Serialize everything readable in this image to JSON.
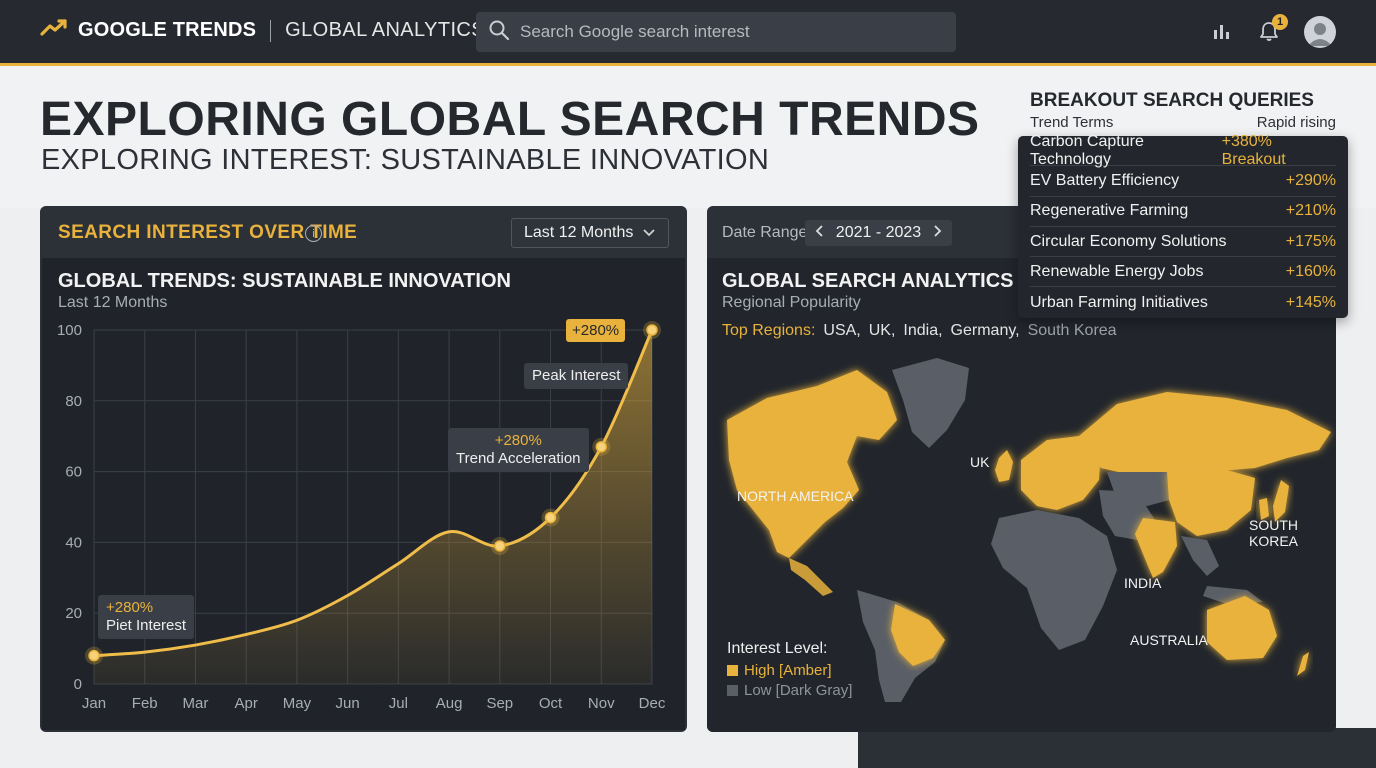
{
  "topbar": {
    "brand": "GOOGLE TRENDS",
    "section": "GLOBAL ANALYTICS",
    "search_placeholder": "Search Google search interest",
    "notification_count": "1",
    "accent": "#e8b23c"
  },
  "hero": {
    "title": "EXPLORING GLOBAL SEARCH TRENDS",
    "subtitle": "EXPLORING INTEREST: SUSTAINABLE INNOVATION"
  },
  "interest_panel": {
    "section_title": "SEARCH INTEREST OVER TIME",
    "timeframe": "Last 12 Months",
    "card_title": "GLOBAL TRENDS: SUSTAINABLE INNOVATION",
    "card_subtitle": "Last 12 Months",
    "annotations": {
      "start_change": "+280%",
      "start_label": "Piet Interest",
      "mid_change": "+280%",
      "mid_label": "Trend Acceleration",
      "peak_label": "Peak Interest",
      "peak_change": "+280%"
    }
  },
  "chart_data": {
    "type": "area",
    "title": "GLOBAL TRENDS: SUSTAINABLE INNOVATION",
    "subtitle": "Last 12 Months",
    "categories": [
      "Jan",
      "Feb",
      "Mar",
      "Apr",
      "May",
      "Jun",
      "Jul",
      "Aug",
      "Sep",
      "Oct",
      "Nov",
      "Dec"
    ],
    "values": [
      8,
      9,
      11,
      14,
      18,
      25,
      34,
      43,
      39,
      47,
      67,
      100
    ],
    "markers": [
      "Jan",
      "Sep",
      "Oct",
      "Nov",
      "Dec"
    ],
    "ylim": [
      0,
      100
    ],
    "yticks": [
      0,
      20,
      40,
      60,
      80,
      100
    ],
    "grid": true,
    "color": "#e8b23c"
  },
  "map_panel": {
    "date_label": "Date Range",
    "date_range": "2021 - 2023",
    "title": "GLOBAL SEARCH ANALYTICS MAP",
    "subtitle": "Regional Popularity",
    "top_regions_label": "Top Regions:",
    "top_regions": [
      "USA,",
      "UK,",
      "India,",
      "Germany,",
      "South Korea"
    ],
    "labels": {
      "north_america": "NORTH AMERICA",
      "uk": "UK",
      "south_korea": "SOUTH KOREA",
      "india": "INDIA",
      "australia": "AUSTRALIA"
    },
    "legend_title": "Interest Level:",
    "legend_high": "High [Amber]",
    "legend_low": "Low [Dark Gray]",
    "high_color": "#e8b23c",
    "low_color": "#5a5f67"
  },
  "breakout": {
    "title": "BREAKOUT SEARCH QUERIES",
    "col_terms": "Trend Terms",
    "col_rising": "Rapid rising",
    "rows": [
      {
        "term": "Carbon Capture Technology",
        "value": "+380% Breakout"
      },
      {
        "term": "EV Battery Efficiency",
        "value": "+290%"
      },
      {
        "term": "Regenerative Farming",
        "value": "+210%"
      },
      {
        "term": "Circular Economy Solutions",
        "value": "+175%"
      },
      {
        "term": "Renewable Energy Jobs",
        "value": "+160%"
      },
      {
        "term": "Urban Farming Initiatives",
        "value": "+145%"
      }
    ]
  }
}
